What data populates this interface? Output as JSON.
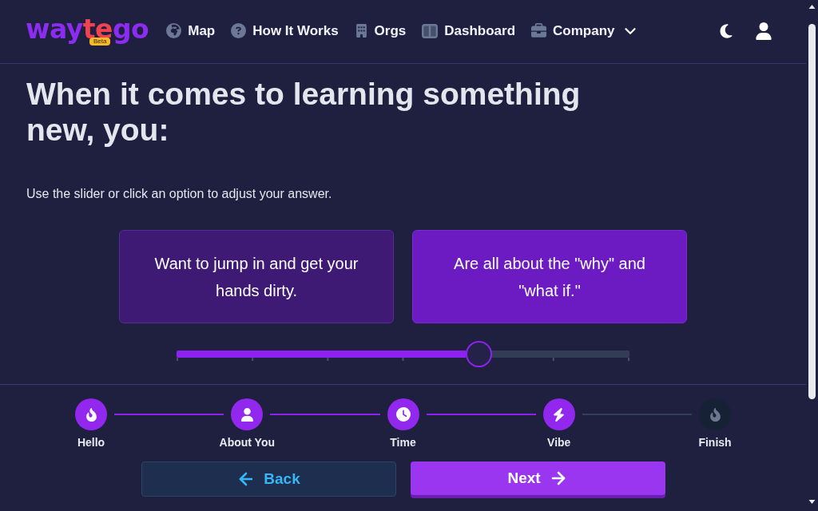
{
  "header": {
    "logo": {
      "parts": [
        {
          "text": "way",
          "highlight": false
        },
        {
          "text": "te",
          "highlight": true
        },
        {
          "text": "go",
          "highlight": false
        }
      ],
      "badge": "Beta"
    },
    "nav": [
      {
        "label": "Map",
        "kind": "link"
      },
      {
        "label": "How It Works",
        "kind": "link"
      },
      {
        "label": "Orgs",
        "kind": "link"
      },
      {
        "label": "Dashboard",
        "kind": "link"
      },
      {
        "label": "Company",
        "kind": "dropdown"
      }
    ]
  },
  "question": {
    "title": "When it comes to learning something new, you:",
    "hint": "Use the slider or click an option to adjust your answer."
  },
  "options": [
    {
      "text": "Want to jump in and get your hands dirty.",
      "selected": false
    },
    {
      "text": "Are all about the \"why\" and \"what if.\"",
      "selected": true
    }
  ],
  "slider": {
    "level": 0.667
  },
  "steps": [
    {
      "label": "Hello",
      "done": true
    },
    {
      "label": "About You",
      "done": true
    },
    {
      "label": "Time",
      "done": true
    },
    {
      "label": "Vibe",
      "done": true
    },
    {
      "label": "Finish",
      "done": false
    }
  ],
  "buttons": [
    {
      "label": "Back",
      "kind": "secondary"
    },
    {
      "label": "Next",
      "kind": "primary"
    }
  ]
}
